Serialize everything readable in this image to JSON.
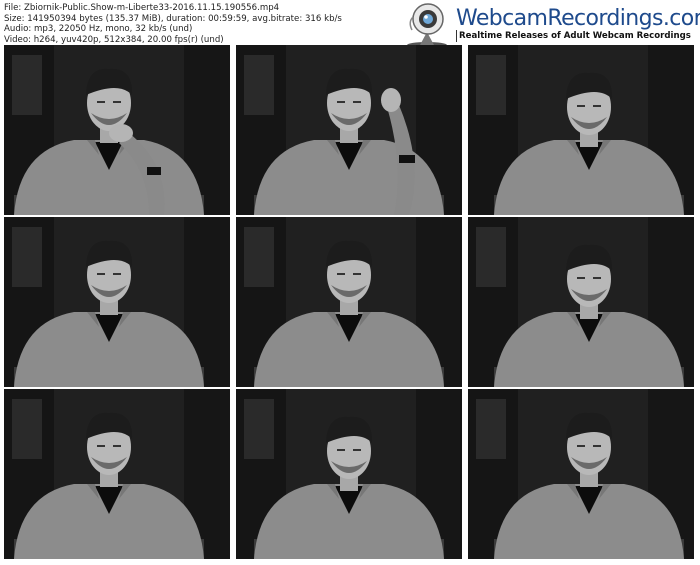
{
  "file_info": {
    "line1": "File: Zbiornik-Public.Show-m-Liberte33-2016.11.15.190556.mp4",
    "line2": "Size: 141950394 bytes (135.37 MiB), duration: 00:59:59, avg.bitrate: 316 kb/s",
    "line3": "Audio: mp3, 22050 Hz, mono, 32 kb/s (und)",
    "line4": "Video: h264, yuv420p, 512x384, 20.00 fps(r) (und)"
  },
  "logo": {
    "brand": "WebcamRecordings.com",
    "tagline": "Realtime Releases of Adult Webcam Recordings",
    "icon": "webcam-icon",
    "brand_color": "#1e4a8c"
  },
  "thumbnails": [
    {
      "pose": "hand-on-chin"
    },
    {
      "pose": "hand-on-head"
    },
    {
      "pose": "looking-down"
    },
    {
      "pose": "facing-camera"
    },
    {
      "pose": "facing-camera"
    },
    {
      "pose": "looking-down"
    },
    {
      "pose": "facing-camera"
    },
    {
      "pose": "looking-down"
    },
    {
      "pose": "facing-camera"
    }
  ]
}
